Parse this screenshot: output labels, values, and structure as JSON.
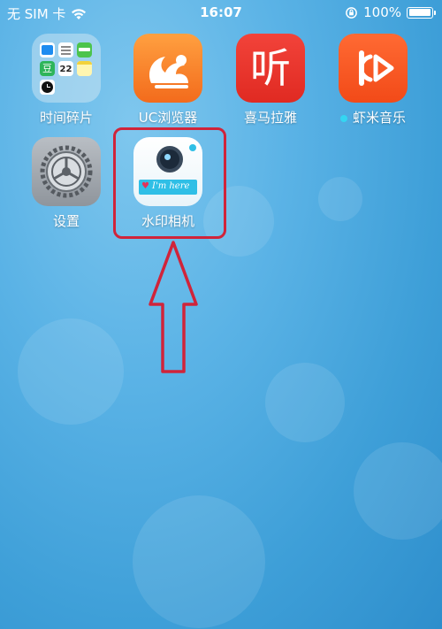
{
  "status_bar": {
    "carrier": "无 SIM 卡",
    "time": "16:07",
    "battery": "100%",
    "battery_level": 1.0
  },
  "folder_calendar_day": "22",
  "folder_douban_char": "豆",
  "xmly_glyph": "听",
  "watermark_banner": "I'm here",
  "apps": {
    "folder": "时间碎片",
    "uc": "UC浏览器",
    "xmly": "喜马拉雅",
    "xiami": "虾米音乐",
    "settings": "设置",
    "watermark": "水印相机"
  },
  "colors": {
    "highlight": "#d0243a",
    "new_dot": "#34d6f2"
  }
}
